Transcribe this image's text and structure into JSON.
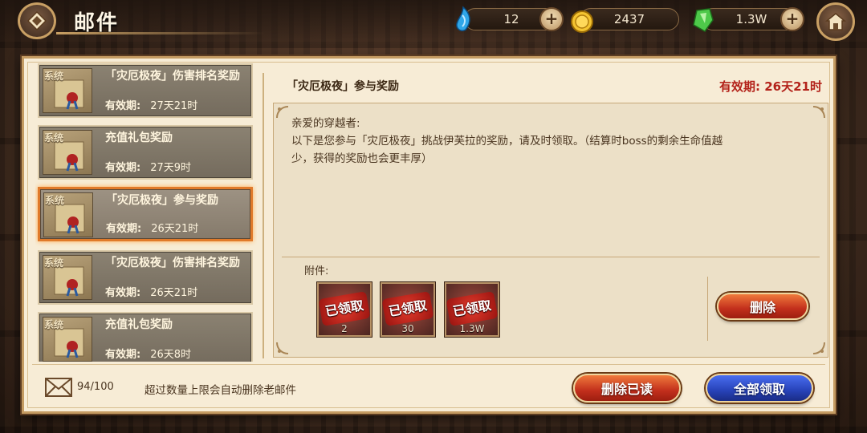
{
  "header": {
    "title": "邮件"
  },
  "resources": [
    {
      "name": "gems",
      "value": "12",
      "icon": "blue-gem-icon"
    },
    {
      "name": "gold",
      "value": "2437",
      "icon": "gold-coin-icon"
    },
    {
      "name": "crystal",
      "value": "1.3W",
      "icon": "green-crystal-icon"
    }
  ],
  "mail_list": {
    "items": [
      {
        "tag": "系统",
        "title": "「灾厄极夜」伤害排名奖励",
        "expire_label": "有效期:",
        "expire_value": "27天21时",
        "selected": false
      },
      {
        "tag": "系统",
        "title": "充值礼包奖励",
        "expire_label": "有效期:",
        "expire_value": "27天9时",
        "selected": false
      },
      {
        "tag": "系统",
        "title": "「灾厄极夜」参与奖励",
        "expire_label": "有效期:",
        "expire_value": "26天21时",
        "selected": true
      },
      {
        "tag": "系统",
        "title": "「灾厄极夜」伤害排名奖励",
        "expire_label": "有效期:",
        "expire_value": "26天21时",
        "selected": false
      },
      {
        "tag": "系统",
        "title": "充值礼包奖励",
        "expire_label": "有效期:",
        "expire_value": "26天8时",
        "selected": false
      }
    ]
  },
  "detail": {
    "title": "「灾厄极夜」参与奖励",
    "expire": "有效期: 26天21时",
    "greeting": "亲爱的穿越者:",
    "body": "以下是您参与「灾厄极夜」挑战伊芙拉的奖励，请及时领取。（结算时boss的剩余生命值越少，获得的奖励也会更丰厚）",
    "attachments_label": "附件:",
    "attachments": [
      {
        "stamp": "已领取",
        "count": "2"
      },
      {
        "stamp": "已领取",
        "count": "30"
      },
      {
        "stamp": "已领取",
        "count": "1.3W"
      }
    ],
    "delete_label": "删除"
  },
  "footer": {
    "mail_count": "94/100",
    "limit_note": "超过数量上限会自动删除老邮件",
    "delete_read_label": "删除已读",
    "claim_all_label": "全部领取"
  },
  "colors": {
    "accent_red": "#b3221a",
    "selected_border": "#e07a2a",
    "button_red": "#c22f1c",
    "button_blue": "#2742b8"
  }
}
